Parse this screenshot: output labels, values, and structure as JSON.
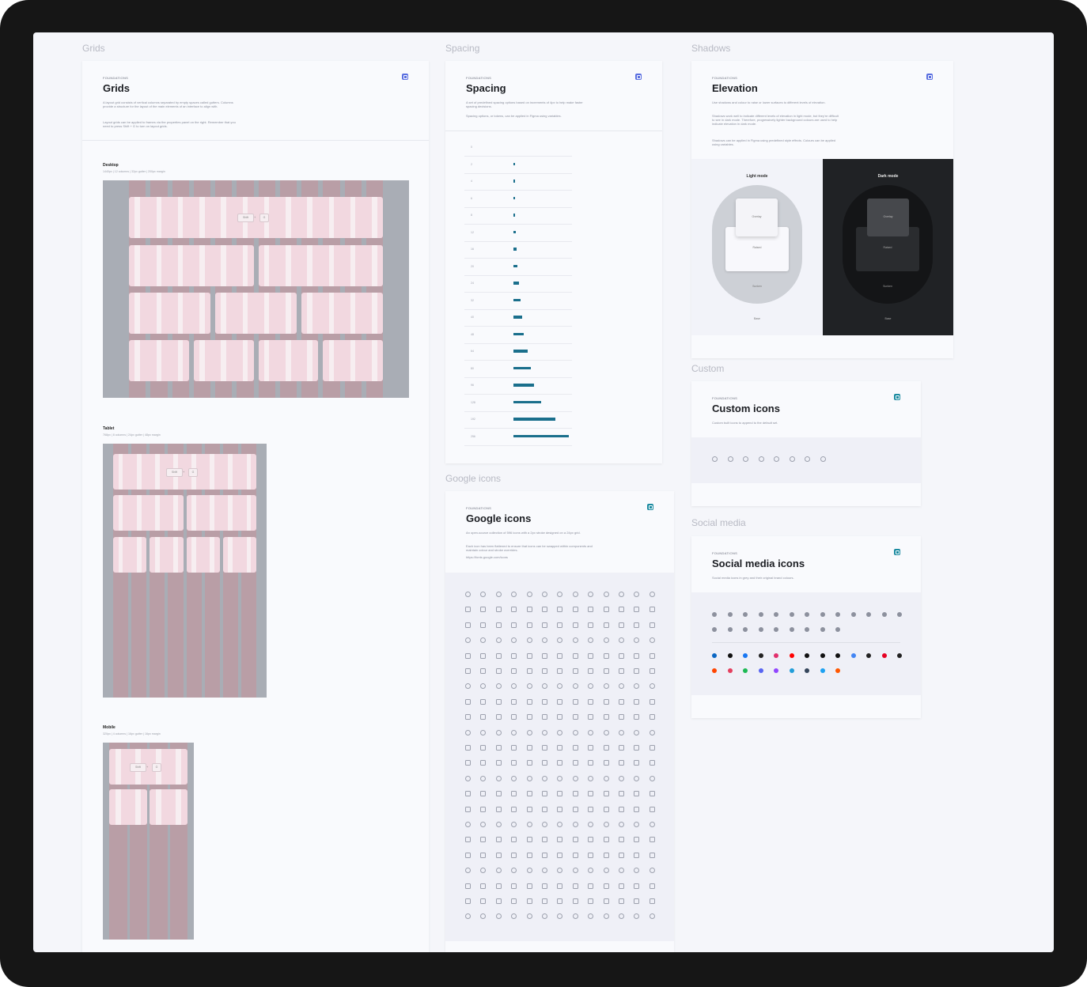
{
  "sections": {
    "grids": "Grids",
    "spacing": "Spacing",
    "shadows": "Shadows",
    "custom": "Custom",
    "google": "Google icons",
    "social": "Social media"
  },
  "grids_card": {
    "eyebrow": "FOUNDATIONS",
    "title": "Grids",
    "desc": "A layout grid consists of vertical columns separated by empty spaces called gutters. Columns provide a structure for the layout of the main elements of an interface to align with.",
    "desc2": "Layout grids can be applied to frames via the properties panel on the right. Remember that you need to press Shift + G to turn on layout grids.",
    "desktop": {
      "title": "Desktop",
      "meta": "1440px | 12 columns | 32px gutter | 200px margin",
      "chip": "Shift",
      "chip_plus": "+",
      "chip_key": "G"
    },
    "tablet": {
      "title": "Tablet",
      "meta": "768px | 8 columns | 24px gutter | 48px margin",
      "chip": "Shift",
      "chip_plus": "+",
      "chip_key": "G"
    },
    "mobile": {
      "title": "Mobile",
      "meta": "320px | 4 columns | 16px gutter | 16px margin",
      "chip": "Shift",
      "chip_plus": "+",
      "chip_key": "G"
    }
  },
  "spacing_card": {
    "eyebrow": "FOUNDATIONS",
    "title": "Spacing",
    "desc": "A set of predefined spacing options based on increments of 4px to help make faster spacing decisions.",
    "desc2": "Spacing options, or tokens, can be applied in Figma using variables.",
    "rows": [
      {
        "label": "0",
        "value": 0
      },
      {
        "label": "2",
        "value": 2
      },
      {
        "label": "4",
        "value": 4
      },
      {
        "label": "6",
        "value": 6
      },
      {
        "label": "8",
        "value": 8
      },
      {
        "label": "12",
        "value": 12
      },
      {
        "label": "16",
        "value": 16
      },
      {
        "label": "20",
        "value": 20
      },
      {
        "label": "24",
        "value": 24
      },
      {
        "label": "32",
        "value": 32
      },
      {
        "label": "40",
        "value": 40
      },
      {
        "label": "48",
        "value": 48
      },
      {
        "label": "64",
        "value": 64
      },
      {
        "label": "80",
        "value": 80
      },
      {
        "label": "96",
        "value": 96
      },
      {
        "label": "128",
        "value": 128
      },
      {
        "label": "192",
        "value": 192
      },
      {
        "label": "256",
        "value": 256
      }
    ]
  },
  "elevation_card": {
    "eyebrow": "FOUNDATIONS",
    "title": "Elevation",
    "desc": "Use shadows and colour to raise or lower surfaces to different levels of elevation.",
    "desc2": "Shadows work well to indicate different levels of elevation in light mode, but they're difficult to see in dark mode. Therefore, progressively lighter background colours are used to help indicate elevation in dark mode.",
    "desc3": "Shadows can be applied in Figma using predefined style effects. Colours can be applied using variables.",
    "light": {
      "title": "Light mode",
      "overlay": "Overlay",
      "raised": "Raised",
      "sunken": "Sunken",
      "base": "Base"
    },
    "dark": {
      "title": "Dark mode",
      "overlay": "Overlay",
      "raised": "Raised",
      "sunken": "Sunken",
      "base": "Base"
    }
  },
  "custom_card": {
    "eyebrow": "FOUNDATIONS",
    "title": "Custom icons",
    "desc": "Custom built icons to append to the default set."
  },
  "google_card": {
    "eyebrow": "FOUNDATIONS",
    "title": "Google icons",
    "desc": "An open-source collection of 596 icons with a 2px stroke designed on a 24px grid.",
    "desc2": "Each icon has been flattened to ensure that icons can be swapped within components and maintain colour and stroke overrides.",
    "link": "https://fonts.google.com/icons"
  },
  "social_card": {
    "eyebrow": "FOUNDATIONS",
    "title": "Social media icons",
    "desc": "Social media icons in grey and their original brand colours."
  },
  "colors": {
    "badge_blue": "#5a6fe0",
    "badge_teal": "#1a8aa0",
    "spacing_bar": "#1a6f8c",
    "dark_panel": "#202225"
  }
}
